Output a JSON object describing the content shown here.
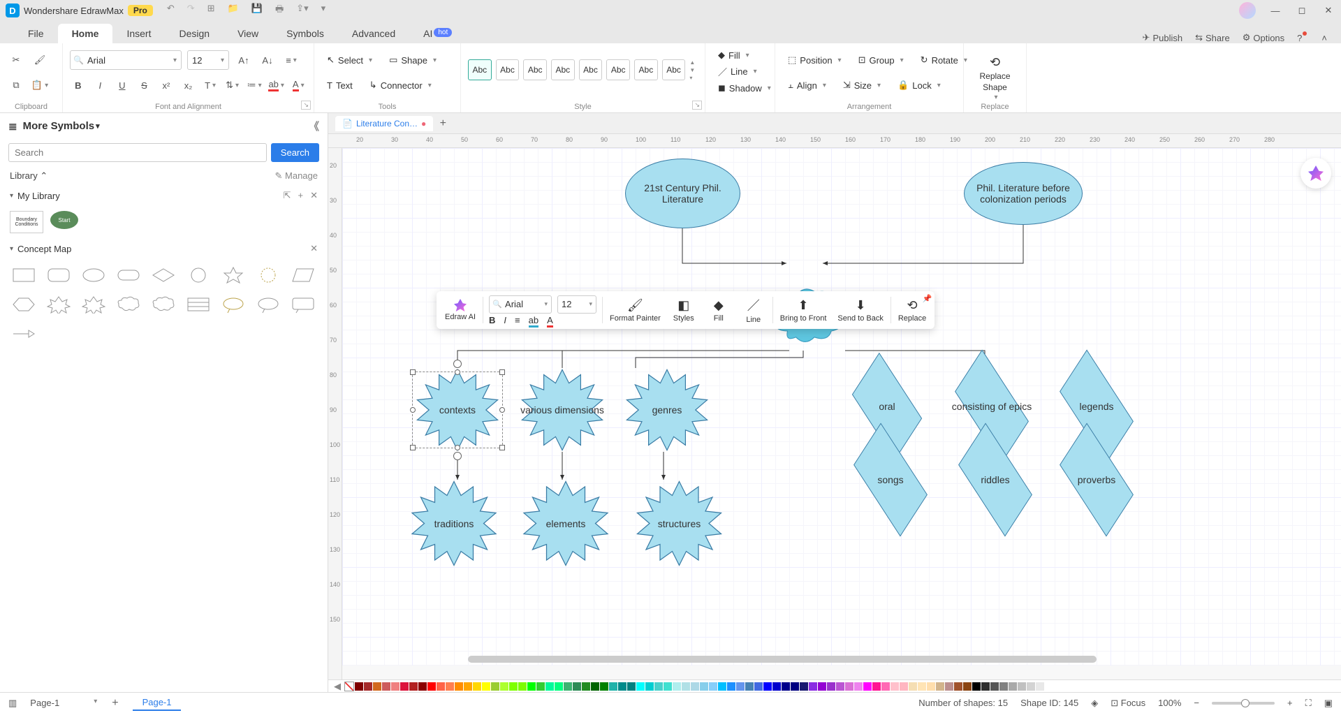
{
  "app": {
    "title": "Wondershare EdrawMax",
    "pro": "Pro"
  },
  "menu": {
    "tabs": [
      "File",
      "Home",
      "Insert",
      "Design",
      "View",
      "Symbols",
      "Advanced",
      "AI"
    ],
    "ai_badge": "hot",
    "right": {
      "publish": "Publish",
      "share": "Share",
      "options": "Options"
    }
  },
  "ribbon": {
    "font": "Arial",
    "size": "12",
    "select": "Select",
    "shape": "Shape",
    "text": "Text",
    "connector": "Connector",
    "style_label": "Abc",
    "fill": "Fill",
    "line": "Line",
    "shadow": "Shadow",
    "position": "Position",
    "group": "Group",
    "rotate": "Rotate",
    "align": "Align",
    "sizeArr": "Size",
    "lock": "Lock",
    "replace_shape_l1": "Replace",
    "replace_shape_l2": "Shape",
    "groups": {
      "clipboard": "Clipboard",
      "font": "Font and Alignment",
      "tools": "Tools",
      "style": "Style",
      "arrangement": "Arrangement",
      "replace": "Replace"
    }
  },
  "sidebar": {
    "title": "More Symbols",
    "search_ph": "Search",
    "search_btn": "Search",
    "library": "Library",
    "manage": "Manage",
    "mylib": "My Library",
    "mylib_thumb": "Boundary Conditions",
    "mylib_oval": "Start",
    "concept": "Concept Map"
  },
  "doc": {
    "tab": "Literature Con…"
  },
  "ruler_h": [
    "20",
    "30",
    "40",
    "50",
    "60",
    "70",
    "80",
    "90",
    "100",
    "110",
    "120",
    "130",
    "140",
    "150",
    "160",
    "170",
    "180",
    "190",
    "200",
    "210",
    "220",
    "230",
    "240",
    "250",
    "260",
    "270",
    "280"
  ],
  "ruler_v": [
    "20",
    "30",
    "40",
    "50",
    "60",
    "70",
    "80",
    "90",
    "100",
    "110",
    "120",
    "130",
    "140",
    "150"
  ],
  "shapes": {
    "oval1": "21st Century Phil. Literature",
    "oval2": "Phil. Literature before colonization periods",
    "contexts": "contexts",
    "various": "various dimensions",
    "genres": "genres",
    "traditions": "traditions",
    "elements": "elements",
    "structures": "structures",
    "oral": "oral",
    "epics": "consisting of epics",
    "legends": "legends",
    "songs": "songs",
    "riddles": "riddles",
    "proverbs": "proverbs"
  },
  "ctx": {
    "edraw_ai": "Edraw AI",
    "font": "Arial",
    "size": "12",
    "format": "Format Painter",
    "styles": "Styles",
    "fill": "Fill",
    "line": "Line",
    "front": "Bring to Front",
    "back": "Send to Back",
    "replace": "Replace"
  },
  "colors": [
    "#800000",
    "#a52a2a",
    "#d2691e",
    "#cd5c5c",
    "#f08080",
    "#dc143c",
    "#b22222",
    "#8b0000",
    "#ff0000",
    "#ff6347",
    "#ff7f50",
    "#ff8c00",
    "#ffa500",
    "#ffd700",
    "#ffff00",
    "#9acd32",
    "#adff2f",
    "#7fff00",
    "#7cfc00",
    "#00ff00",
    "#32cd32",
    "#00fa9a",
    "#00ff7f",
    "#3cb371",
    "#2e8b57",
    "#228b22",
    "#006400",
    "#008000",
    "#20b2aa",
    "#008b8b",
    "#008080",
    "#00ffff",
    "#00ced1",
    "#48d1cc",
    "#40e0d0",
    "#afeeee",
    "#b0e0e6",
    "#add8e6",
    "#87ceeb",
    "#87cefa",
    "#00bfff",
    "#1e90ff",
    "#6495ed",
    "#4682b4",
    "#4169e1",
    "#0000ff",
    "#0000cd",
    "#00008b",
    "#000080",
    "#191970",
    "#8a2be2",
    "#9400d3",
    "#9932cc",
    "#ba55d3",
    "#da70d6",
    "#ee82ee",
    "#ff00ff",
    "#ff1493",
    "#ff69b4",
    "#ffc0cb",
    "#ffb6c1",
    "#f5deb3",
    "#ffe4b5",
    "#ffdead",
    "#d2b48c",
    "#bc8f8f",
    "#a0522d",
    "#8b4513",
    "#000000",
    "#2f2f2f",
    "#555555",
    "#808080",
    "#a9a9a9",
    "#c0c0c0",
    "#d3d3d3",
    "#e8e8e8",
    "#ffffff"
  ],
  "status": {
    "page_sel": "Page-1",
    "page_tab": "Page-1",
    "shapes": "Number of shapes: 15",
    "shape_id": "Shape ID: 145",
    "focus": "Focus",
    "zoom": "100%"
  }
}
